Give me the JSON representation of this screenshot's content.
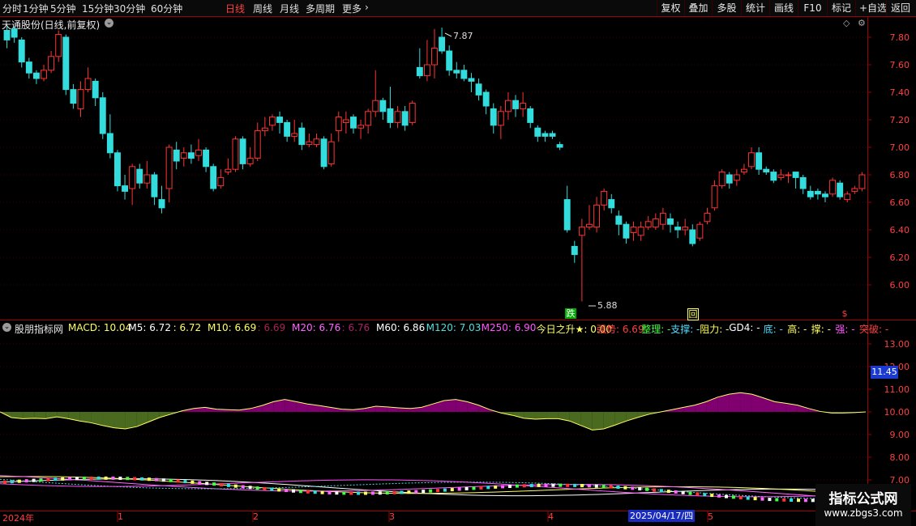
{
  "toolbar": {
    "periods": [
      "分时",
      "1分钟",
      "5分钟",
      "15分钟",
      "30分钟",
      "60分钟",
      "日线",
      "周线",
      "月线",
      "多周期",
      "更多"
    ],
    "active_period": "日线",
    "right_buttons": [
      "复权",
      "叠加",
      "多股",
      "统计",
      "画线",
      "F10",
      "标记",
      "+自选",
      "返回"
    ]
  },
  "chart_title": "天通股份(日线,前复权)",
  "price_axis": [
    "7.80",
    "7.60",
    "7.40",
    "7.20",
    "7.00",
    "6.80",
    "6.60",
    "6.40",
    "6.20",
    "6.00"
  ],
  "annotations": {
    "high": "7.87",
    "low": "5.88"
  },
  "signals": {
    "drop": "跌",
    "back": "回",
    "money": "$"
  },
  "indicator": {
    "name": "股朋指标网",
    "items": [
      {
        "label": "MACD: 10.04",
        "color": "#ffff66"
      },
      {
        "label": "M5: 6.72",
        "color": "#ffffff"
      },
      {
        "label": ": 6.72",
        "color": "#ffff66"
      },
      {
        "label": "M10: 6.69",
        "color": "#ffff66"
      },
      {
        "label": ": 6.69",
        "color": "#aa2255"
      },
      {
        "label": "M20: 6.76",
        "color": "#ff66ff"
      },
      {
        "label": ": 6.76",
        "color": "#aa2266"
      },
      {
        "label": "M60: 6.86",
        "color": "#ffffff"
      },
      {
        "label": "M120: 7.03",
        "color": "#55dddd"
      },
      {
        "label": "M250: 6.90",
        "color": "#ff55ff"
      },
      {
        "label": "今日之升★: 0.00",
        "color": "#ffff66"
      },
      {
        "label": "强势: 6.69",
        "color": "#ff4040"
      },
      {
        "label": "整理: -",
        "color": "#44ff44"
      },
      {
        "label": "支撑: -",
        "color": "#55ddff"
      },
      {
        "label": "阻力: -",
        "color": "#ffff55"
      },
      {
        "label": "GD4: -",
        "color": "#ffffff"
      },
      {
        "label": "底: -",
        "color": "#44ddff"
      },
      {
        "label": "高: -",
        "color": "#ffff66"
      },
      {
        "label": "撑: -",
        "color": "#ffff66"
      },
      {
        "label": "强: -",
        "color": "#ff55ff"
      },
      {
        "label": "突破: -",
        "color": "#ff4040"
      }
    ]
  },
  "ind_axis": [
    "13.00",
    "12.00",
    "11.00",
    "10.00",
    "9.00",
    "8.00",
    "7.00"
  ],
  "ind_current": "11.45",
  "dates": [
    "2024年",
    "1",
    "2",
    "3",
    "4",
    "5"
  ],
  "cursor_date": "2025/04/17/四",
  "watermark": {
    "title": "指标公式网",
    "url": "www.zbgs3.com"
  },
  "colors": {
    "up": "#ff3333",
    "down": "#33dddd",
    "axis": "#a00000"
  },
  "chart_data": {
    "type": "candlestick",
    "yaxis_range": [
      5.85,
      7.95
    ],
    "candles": [
      [
        7.85,
        7.78,
        7.88,
        7.72
      ],
      [
        7.86,
        7.8,
        7.88,
        7.76
      ],
      [
        7.78,
        7.62,
        7.8,
        7.58
      ],
      [
        7.62,
        7.54,
        7.65,
        7.5
      ],
      [
        7.54,
        7.5,
        7.56,
        7.46
      ],
      [
        7.5,
        7.56,
        7.6,
        7.48
      ],
      [
        7.56,
        7.66,
        7.7,
        7.54
      ],
      [
        7.66,
        7.82,
        7.85,
        7.62
      ],
      [
        7.8,
        7.42,
        7.82,
        7.38
      ],
      [
        7.42,
        7.32,
        7.46,
        7.28
      ],
      [
        7.28,
        7.42,
        7.48,
        7.22
      ],
      [
        7.42,
        7.5,
        7.58,
        7.4
      ],
      [
        7.48,
        7.36,
        7.5,
        7.3
      ],
      [
        7.36,
        7.1,
        7.4,
        7.06
      ],
      [
        7.1,
        6.96,
        7.24,
        6.92
      ],
      [
        6.96,
        6.72,
        6.98,
        6.68
      ],
      [
        6.72,
        6.68,
        6.8,
        6.62
      ],
      [
        6.7,
        6.86,
        6.88,
        6.58
      ],
      [
        6.84,
        6.74,
        6.88,
        6.7
      ],
      [
        6.74,
        6.8,
        6.9,
        6.7
      ],
      [
        6.8,
        6.64,
        6.82,
        6.58
      ],
      [
        6.62,
        6.56,
        6.72,
        6.52
      ],
      [
        6.7,
        7.0,
        7.02,
        6.6
      ],
      [
        6.98,
        6.9,
        7.04,
        6.84
      ],
      [
        6.92,
        6.96,
        7.0,
        6.86
      ],
      [
        6.96,
        6.92,
        7.02,
        6.88
      ],
      [
        6.94,
        6.98,
        7.06,
        6.9
      ],
      [
        6.98,
        6.86,
        7.0,
        6.82
      ],
      [
        6.86,
        6.7,
        6.88,
        6.68
      ],
      [
        6.72,
        6.78,
        6.84,
        6.7
      ],
      [
        6.82,
        6.84,
        6.92,
        6.8
      ],
      [
        6.84,
        7.06,
        7.08,
        6.82
      ],
      [
        7.06,
        6.88,
        7.08,
        6.84
      ],
      [
        6.88,
        6.92,
        7.0,
        6.86
      ],
      [
        6.92,
        7.12,
        7.18,
        6.9
      ],
      [
        7.12,
        7.14,
        7.22,
        7.08
      ],
      [
        7.16,
        7.22,
        7.24,
        7.12
      ],
      [
        7.22,
        7.18,
        7.26,
        7.1
      ],
      [
        7.18,
        7.08,
        7.2,
        7.04
      ],
      [
        7.08,
        7.1,
        7.2,
        7.04
      ],
      [
        7.14,
        7.02,
        7.18,
        6.98
      ],
      [
        7.02,
        7.04,
        7.1,
        7.0
      ],
      [
        7.02,
        7.06,
        7.1,
        7.0
      ],
      [
        7.06,
        6.86,
        7.08,
        6.84
      ],
      [
        6.88,
        7.04,
        7.1,
        6.86
      ],
      [
        7.12,
        7.22,
        7.26,
        7.04
      ],
      [
        7.18,
        7.2,
        7.26,
        7.1
      ],
      [
        7.22,
        7.14,
        7.24,
        7.1
      ],
      [
        7.14,
        7.16,
        7.2,
        7.06
      ],
      [
        7.16,
        7.26,
        7.28,
        7.1
      ],
      [
        7.26,
        7.34,
        7.56,
        7.22
      ],
      [
        7.34,
        7.26,
        7.36,
        7.2
      ],
      [
        7.28,
        7.18,
        7.44,
        7.14
      ],
      [
        7.18,
        7.26,
        7.3,
        7.14
      ],
      [
        7.26,
        7.16,
        7.3,
        7.12
      ],
      [
        7.18,
        7.32,
        7.34,
        7.16
      ],
      [
        7.58,
        7.52,
        7.72,
        7.5
      ],
      [
        7.52,
        7.6,
        7.78,
        7.48
      ],
      [
        7.6,
        7.72,
        7.86,
        7.5
      ],
      [
        7.8,
        7.7,
        7.87,
        7.68
      ],
      [
        7.7,
        7.56,
        7.74,
        7.52
      ],
      [
        7.56,
        7.54,
        7.62,
        7.5
      ],
      [
        7.56,
        7.5,
        7.6,
        7.48
      ],
      [
        7.5,
        7.48,
        7.54,
        7.4
      ],
      [
        7.46,
        7.38,
        7.5,
        7.34
      ],
      [
        7.4,
        7.3,
        7.42,
        7.24
      ],
      [
        7.28,
        7.16,
        7.32,
        7.1
      ],
      [
        7.16,
        7.26,
        7.3,
        7.06
      ],
      [
        7.26,
        7.34,
        7.4,
        7.2
      ],
      [
        7.34,
        7.28,
        7.38,
        7.22
      ],
      [
        7.28,
        7.32,
        7.4,
        7.22
      ],
      [
        7.28,
        7.18,
        7.3,
        7.14
      ],
      [
        7.14,
        7.08,
        7.16,
        7.04
      ],
      [
        7.1,
        7.08,
        7.12,
        7.04
      ],
      [
        7.1,
        7.08,
        7.12,
        7.06
      ],
      [
        7.02,
        7.0,
        7.04,
        6.98
      ],
      [
        6.62,
        6.4,
        6.72,
        6.38
      ],
      [
        6.28,
        6.22,
        6.32,
        6.16
      ],
      [
        6.36,
        6.42,
        6.48,
        5.88
      ],
      [
        6.42,
        6.44,
        6.58,
        6.4
      ],
      [
        6.42,
        6.58,
        6.64,
        6.38
      ],
      [
        6.58,
        6.68,
        6.7,
        6.54
      ],
      [
        6.62,
        6.56,
        6.66,
        6.52
      ],
      [
        6.5,
        6.44,
        6.54,
        6.36
      ],
      [
        6.44,
        6.34,
        6.46,
        6.3
      ],
      [
        6.38,
        6.42,
        6.46,
        6.32
      ],
      [
        6.36,
        6.42,
        6.46,
        6.32
      ],
      [
        6.42,
        6.46,
        6.5,
        6.4
      ],
      [
        6.42,
        6.48,
        6.52,
        6.4
      ],
      [
        6.44,
        6.52,
        6.56,
        6.4
      ],
      [
        6.48,
        6.44,
        6.52,
        6.38
      ],
      [
        6.42,
        6.4,
        6.46,
        6.34
      ],
      [
        6.4,
        6.42,
        6.48,
        6.36
      ],
      [
        6.4,
        6.3,
        6.44,
        6.28
      ],
      [
        6.34,
        6.44,
        6.46,
        6.32
      ],
      [
        6.46,
        6.52,
        6.56,
        6.44
      ],
      [
        6.56,
        6.72,
        6.76,
        6.54
      ],
      [
        6.72,
        6.82,
        6.84,
        6.7
      ],
      [
        6.8,
        6.74,
        6.82,
        6.7
      ],
      [
        6.76,
        6.8,
        6.84,
        6.72
      ],
      [
        6.82,
        6.84,
        6.88,
        6.8
      ],
      [
        6.86,
        6.96,
        7.0,
        6.84
      ],
      [
        6.96,
        6.84,
        7.0,
        6.8
      ],
      [
        6.84,
        6.82,
        6.86,
        6.8
      ],
      [
        6.82,
        6.76,
        6.84,
        6.74
      ],
      [
        6.78,
        6.8,
        6.84,
        6.76
      ],
      [
        6.8,
        6.8,
        6.82,
        6.74
      ],
      [
        6.82,
        6.78,
        6.82,
        6.7
      ],
      [
        6.78,
        6.7,
        6.8,
        6.66
      ],
      [
        6.68,
        6.64,
        6.72,
        6.62
      ],
      [
        6.68,
        6.66,
        6.7,
        6.62
      ],
      [
        6.66,
        6.64,
        6.68,
        6.6
      ],
      [
        6.66,
        6.76,
        6.78,
        6.64
      ],
      [
        6.74,
        6.64,
        6.76,
        6.62
      ],
      [
        6.62,
        6.66,
        6.68,
        6.6
      ],
      [
        6.68,
        6.7,
        6.72,
        6.66
      ],
      [
        6.7,
        6.8,
        6.82,
        6.68
      ]
    ],
    "macd_area": {
      "baseline": 10.0,
      "range": [
        7.0,
        13.5
      ],
      "values": [
        10.0,
        9.75,
        9.7,
        9.72,
        9.7,
        9.78,
        9.7,
        9.6,
        9.52,
        9.4,
        9.3,
        9.25,
        9.35,
        9.55,
        9.75,
        9.9,
        10.05,
        10.15,
        10.2,
        10.12,
        10.1,
        10.08,
        10.15,
        10.28,
        10.45,
        10.55,
        10.45,
        10.35,
        10.28,
        10.2,
        10.12,
        10.1,
        10.15,
        10.25,
        10.22,
        10.18,
        10.15,
        10.2,
        10.35,
        10.5,
        10.55,
        10.45,
        10.3,
        10.1,
        9.95,
        9.85,
        9.72,
        9.68,
        9.7,
        9.7,
        9.6,
        9.4,
        9.2,
        9.25,
        9.42,
        9.6,
        9.76,
        9.9,
        10.0,
        10.1,
        10.2,
        10.3,
        10.45,
        10.65,
        10.78,
        10.85,
        10.78,
        10.62,
        10.45,
        10.38,
        10.3,
        10.15,
        10.02,
        9.95,
        9.95,
        9.97,
        10.0
      ]
    }
  }
}
